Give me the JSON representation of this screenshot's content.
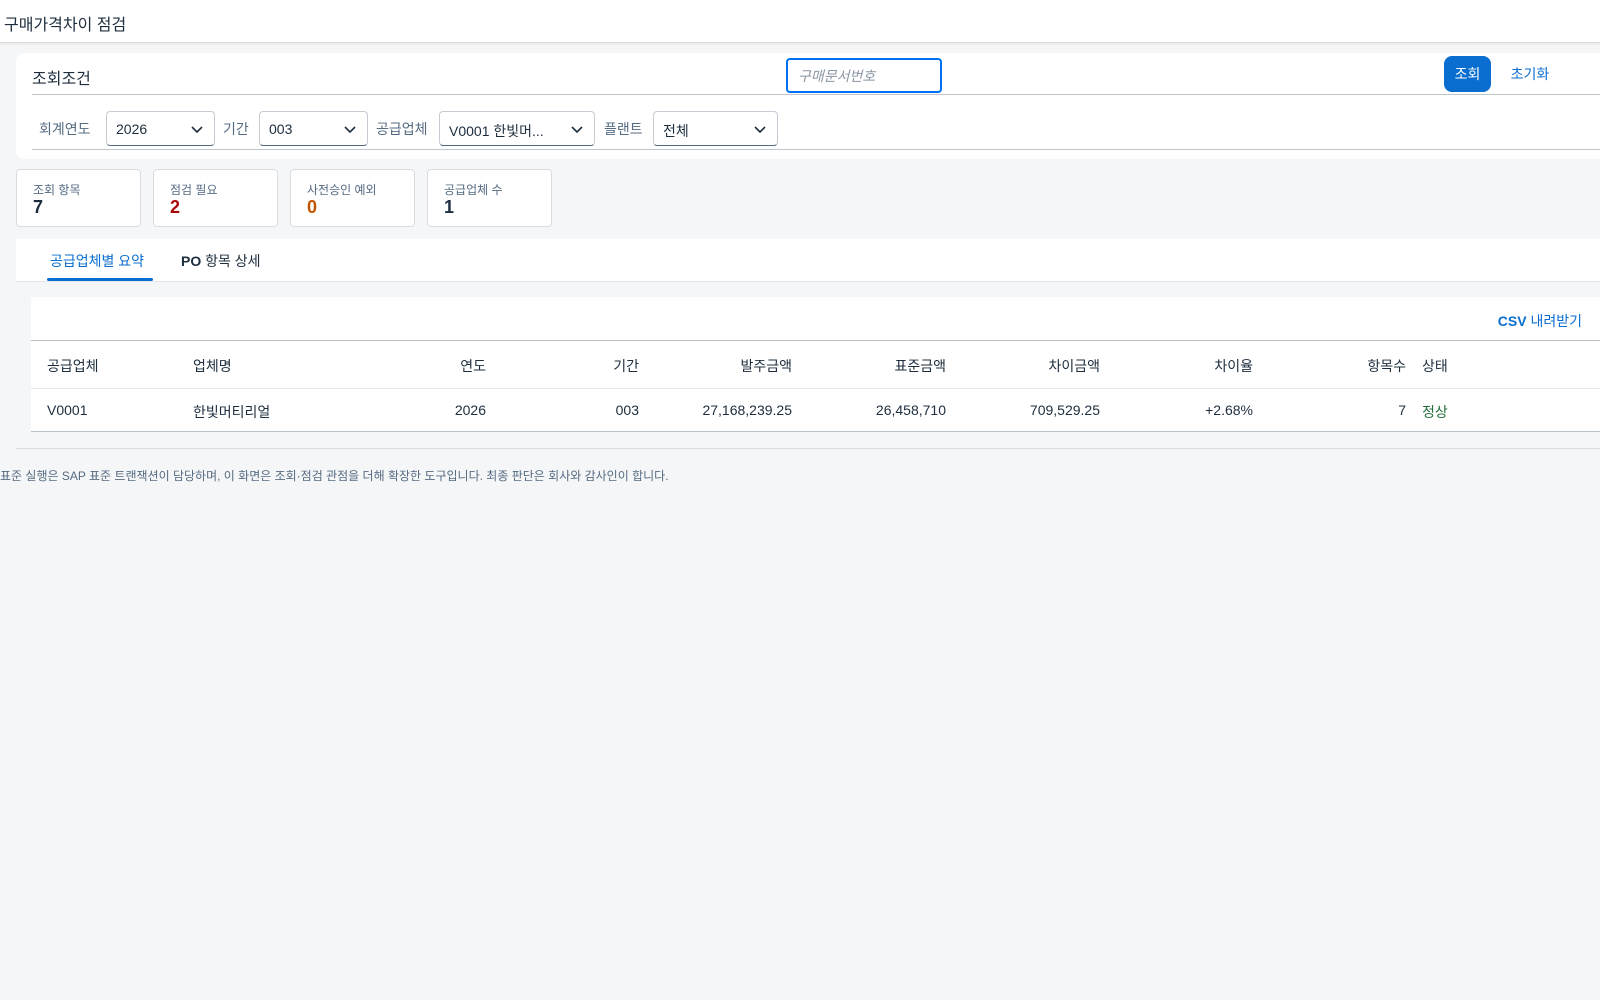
{
  "app": {
    "title": "구매가격차이 점검"
  },
  "filters": {
    "section_title": "조회조건",
    "fiscal_year": {
      "label": "회계연도",
      "value": "2026"
    },
    "period": {
      "label": "기간",
      "value": "003"
    },
    "vendor": {
      "label": "공급업체",
      "value": "V0001 한빛머..."
    },
    "plant": {
      "label": "플랜트",
      "value": "전체"
    },
    "po_number": {
      "placeholder": "구매문서번호",
      "value": ""
    },
    "search_button": "조회",
    "reset_button": "초기화"
  },
  "kpis": [
    {
      "label": "조회 항목",
      "value": "7",
      "color": "#1d2d3e"
    },
    {
      "label": "점검 필요",
      "value": "2",
      "color": "#aa0808"
    },
    {
      "label": "사전승인 예외",
      "value": "0",
      "color": "#c35500"
    },
    {
      "label": "공급업체 수",
      "value": "1",
      "color": "#1d2d3e"
    }
  ],
  "tabs": [
    {
      "label": "공급업체별 요약",
      "selected": true
    },
    {
      "label_bold": "PO",
      "label_rest": " 항목 상세",
      "selected": false
    }
  ],
  "table": {
    "csv_bold": "CSV",
    "csv_rest": " 내려받기",
    "columns": [
      "공급업체",
      "업체명",
      "연도",
      "기간",
      "발주금액",
      "표준금액",
      "차이금액",
      "차이율",
      "항목수",
      "상태"
    ],
    "rows": [
      [
        "V0001",
        "한빛머티리얼",
        "2026",
        "003",
        "27,168,239.25",
        "26,458,710",
        "709,529.25",
        "+2.68%",
        "7",
        "정상"
      ]
    ]
  },
  "footer_note": "표준 실행은 SAP 표준 트랜잭션이 담당하며, 이 화면은 조회·점검 관점을 더해 확장한 도구입니다. 최종 판단은 회사와 감사인이 합니다.",
  "colors": {
    "accent": "#0a6ed1",
    "status_ok": "#256f3a"
  }
}
